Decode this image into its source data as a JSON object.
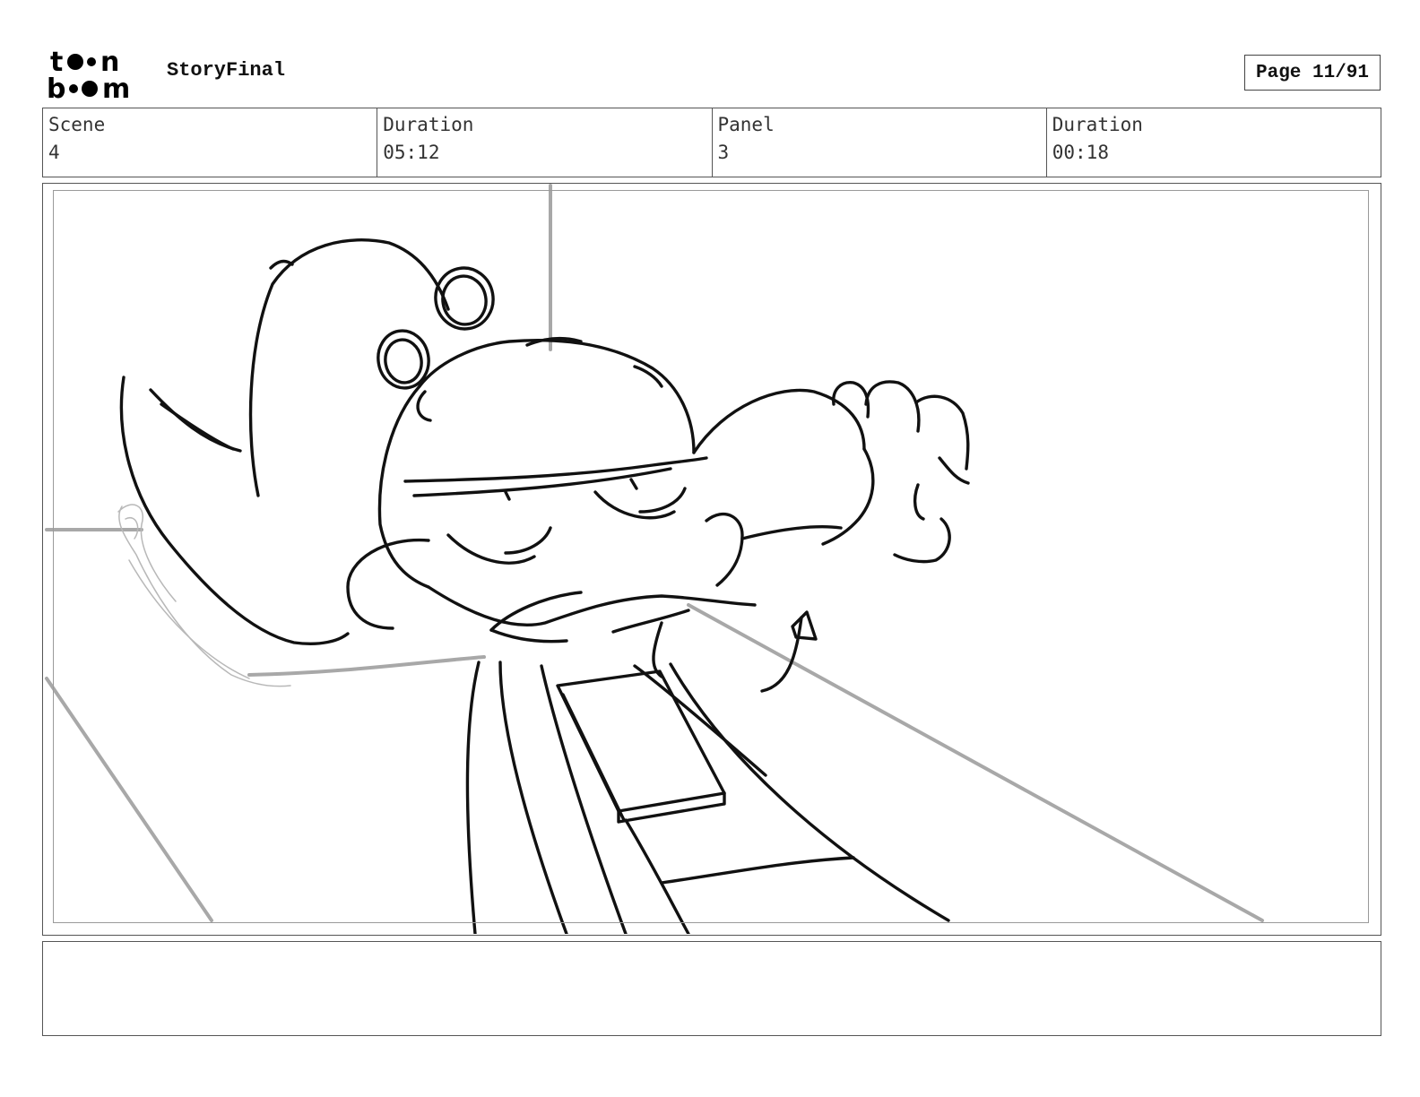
{
  "header": {
    "logo_text": "toon boom",
    "project_title": "StoryFinal",
    "page_label": "Page 11/91"
  },
  "info": [
    {
      "label": "Scene",
      "value": "4"
    },
    {
      "label": "Duration",
      "value": "05:12"
    },
    {
      "label": "Panel",
      "value": "3"
    },
    {
      "label": "Duration",
      "value": "00:18"
    }
  ],
  "panel": {
    "image": "storyboard-sketch-character-reaching"
  },
  "notes": {
    "text": ""
  }
}
